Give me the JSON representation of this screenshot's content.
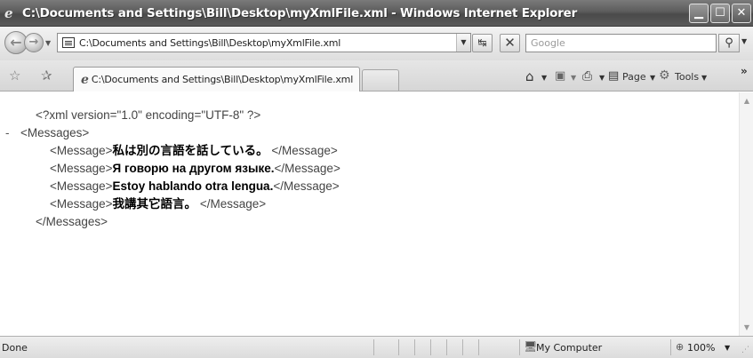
{
  "window": {
    "title": "C:\\Documents and Settings\\Bill\\Desktop\\myXmlFile.xml - Windows Internet Explorer",
    "buttons": {
      "minimize": "_",
      "maximize": "□",
      "close": "X"
    }
  },
  "address_bar": {
    "url": "C:\\Documents and Settings\\Bill\\Desktop\\myXmlFile.xml",
    "search_placeholder": "Google"
  },
  "tabs": [
    {
      "label": "C:\\Documents and Settings\\Bill\\Desktop\\myXmlFile.xml",
      "active": true
    }
  ],
  "command_bar": {
    "page_label": "Page",
    "tools_label": "Tools"
  },
  "document": {
    "declaration": "<?xml version=\"1.0\" encoding=\"UTF-8\" ?>",
    "collapse_marker": "-",
    "root_open": "<Messages>",
    "root_close": "</Messages>",
    "item_open": "<Message>",
    "item_close": "</Message>",
    "messages": [
      "私は別の言語を話している。",
      "Я говорю на другом языке.",
      "Estoy hablando otra lengua.",
      "我講其它語言。"
    ]
  },
  "status_bar": {
    "status": "Done",
    "zone": "My Computer",
    "zoom": "100%"
  },
  "icons": {
    "back": "back-arrow-icon",
    "forward": "forward-arrow-icon",
    "refresh": "refresh-icon",
    "stop": "stop-icon",
    "search": "search-icon",
    "favorites": "favorites-star-icon",
    "add_favorite": "add-favorite-icon",
    "home": "home-icon",
    "feeds": "feeds-icon",
    "print": "print-icon",
    "page": "page-icon",
    "tools": "tools-gear-icon",
    "computer": "computer-icon",
    "zoom": "zoom-icon"
  }
}
